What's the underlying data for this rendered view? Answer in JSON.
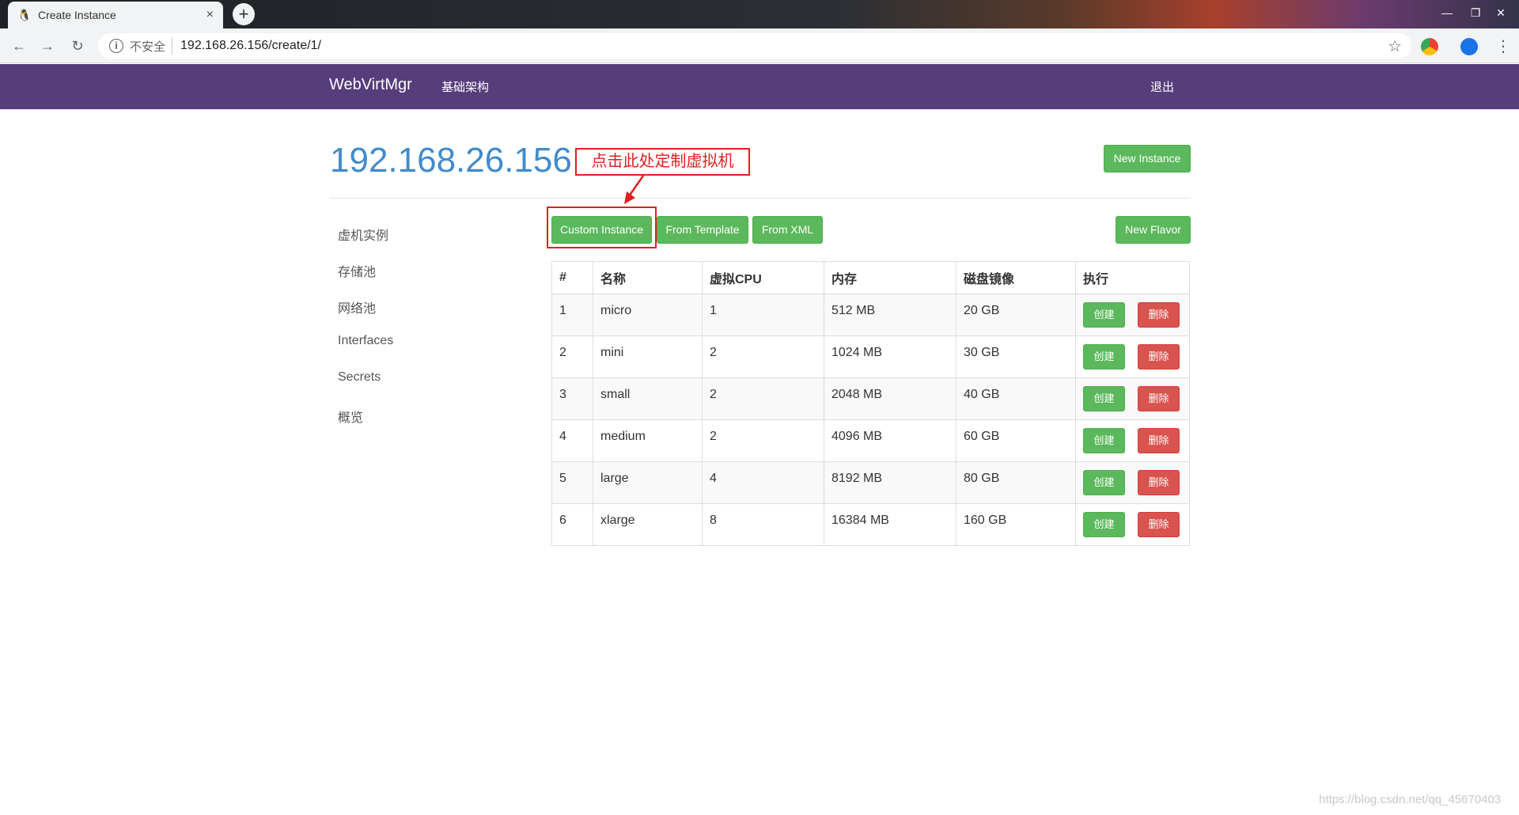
{
  "browser": {
    "tab_title": "Create Instance",
    "tab_close": "×",
    "new_tab": "+",
    "insecure_label": "不安全",
    "url": "192.168.26.156/create/1/",
    "info_glyph": "i",
    "star_glyph": "☆",
    "back_glyph": "←",
    "forward_glyph": "→",
    "reload_glyph": "↻",
    "minimize_glyph": "—",
    "restore_glyph": "❐",
    "close_glyph": "✕",
    "menu_glyph": "⋮"
  },
  "navbar": {
    "brand": "WebVirtMgr",
    "infrastructure": "基础架构",
    "logout": "退出"
  },
  "header": {
    "host": "192.168.26.156",
    "new_instance": "New Instance"
  },
  "annotation": {
    "callout": "点击此处定制虚拟机",
    "color": "#e02020"
  },
  "toolbar": {
    "custom_instance": "Custom Instance",
    "from_template": "From Template",
    "from_xml": "From XML",
    "new_flavor": "New Flavor"
  },
  "sidebar": {
    "items": [
      "虚机实例",
      "存储池",
      "网络池",
      "Interfaces",
      "Secrets",
      "概览"
    ]
  },
  "table": {
    "headers": [
      "#",
      "名称",
      "虚拟CPU",
      "内存",
      "磁盘镜像",
      "执行"
    ],
    "create_label": "创建",
    "delete_label": "删除",
    "rows": [
      [
        "1",
        "micro",
        "1",
        "512 MB",
        "20 GB"
      ],
      [
        "2",
        "mini",
        "2",
        "1024 MB",
        "30 GB"
      ],
      [
        "3",
        "small",
        "2",
        "2048 MB",
        "40 GB"
      ],
      [
        "4",
        "medium",
        "2",
        "4096 MB",
        "60 GB"
      ],
      [
        "5",
        "large",
        "4",
        "8192 MB",
        "80 GB"
      ],
      [
        "6",
        "xlarge",
        "8",
        "16384 MB",
        "160 GB"
      ]
    ]
  },
  "watermark": "https://blog.csdn.net/qq_45670403",
  "colors": {
    "navbar": "#563d7c",
    "title": "#428bca",
    "success": "#5cb85c",
    "danger": "#d9534f"
  }
}
